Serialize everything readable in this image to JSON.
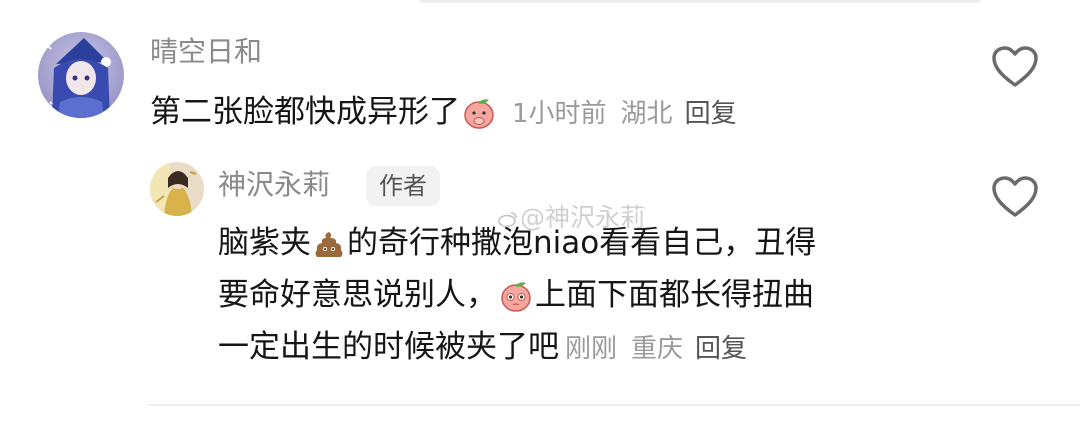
{
  "comment": {
    "username": "晴空日和",
    "text": "第二张脸都快成异形了",
    "time": "1小时前",
    "location": "湖北",
    "reply_label": "回复",
    "emoji_icon": "peach-face-emoji"
  },
  "reply": {
    "username": "神沢永莉",
    "badge": "作者",
    "line1_a": "脑紫夹",
    "line1_b": "的奇行种撒泡niao看看自己，丑得",
    "line2_a": "要命好意思说别人，",
    "line2_b": "上面下面都长得扭曲",
    "line3": "一定出生的时候被夹了吧",
    "time": "刚刚",
    "location": "重庆",
    "reply_label": "回复"
  },
  "watermark": "@神沢永莉",
  "colors": {
    "meta_gray": "#9a9a9a",
    "username_gray": "#8a8a8a",
    "heart_gray": "#6b6b6b",
    "peach": "#f7a7a0"
  }
}
